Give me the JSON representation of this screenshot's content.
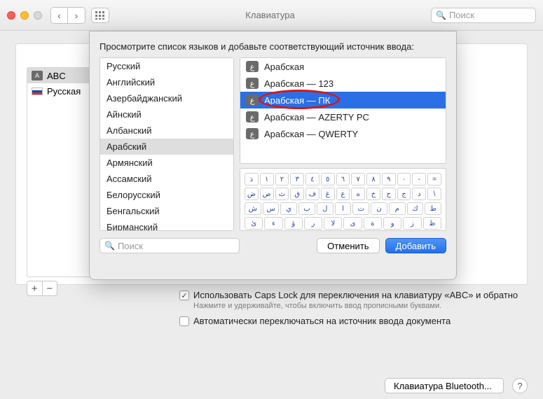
{
  "window": {
    "title": "Клавиатура"
  },
  "toolbar": {
    "search_placeholder": "Поиск"
  },
  "sidebar_sources": [
    {
      "label": "ABC",
      "badge": "A"
    },
    {
      "label": "Русская",
      "flag": "ru"
    }
  ],
  "options": {
    "capslock_label": "Использовать Caps Lock для переключения на клавиатуру «ABC» и обратно",
    "capslock_hint": "Нажмите и удерживайте, чтобы включить ввод прописными буквами.",
    "autoswitch_label": "Автоматически переключаться на источник ввода документа"
  },
  "bottom": {
    "bluetooth": "Клавиатура Bluetooth...",
    "help": "?"
  },
  "sheet": {
    "instruction": "Просмотрите список языков и добавьте соответствующий источник ввода:",
    "search_placeholder": "Поиск",
    "cancel": "Отменить",
    "add": "Добавить",
    "languages": [
      "Русский",
      "Английский",
      "Азербайджанский",
      "Айнский",
      "Албанский",
      "Арабский",
      "Армянский",
      "Ассамский",
      "Белорусский",
      "Бенгальский",
      "Бирманский"
    ],
    "selected_language_index": 5,
    "layouts": [
      "Арабская",
      "Арабская — 123",
      "Арабская — ПК",
      "Арабская — AZERTY PC",
      "Арабская — QWERTY"
    ],
    "selected_layout_index": 2,
    "ar_glyph": "ع",
    "keyboard_rows": [
      [
        "ذ",
        "١",
        "٢",
        "٣",
        "٤",
        "٥",
        "٦",
        "٧",
        "٨",
        "٩",
        "٠",
        "-",
        "="
      ],
      [
        "ض",
        "ص",
        "ث",
        "ق",
        "ف",
        "غ",
        "ع",
        "ه",
        "خ",
        "ح",
        "ج",
        "د",
        "\\"
      ],
      [
        "ش",
        "س",
        "ي",
        "ب",
        "ل",
        "ا",
        "ت",
        "ن",
        "م",
        "ك",
        "ط"
      ],
      [
        "ئ",
        "ء",
        "ؤ",
        "ر",
        "لا",
        "ى",
        "ة",
        "و",
        "ز",
        "ظ"
      ]
    ]
  }
}
